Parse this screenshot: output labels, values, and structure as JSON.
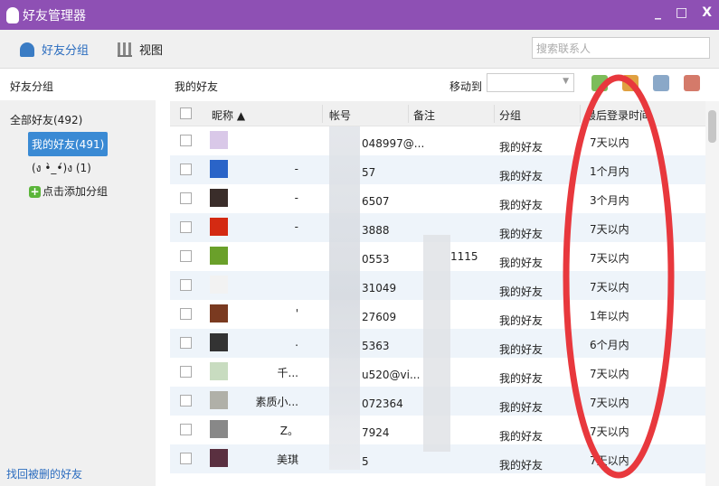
{
  "window": {
    "title": "好友管理器",
    "minimize": "_",
    "maximize": "□",
    "close": "X"
  },
  "toolbar": {
    "groups_tab": "好友分组",
    "view_tab": "视图",
    "search_placeholder": "搜索联系人"
  },
  "sidebar": {
    "header": "好友分组",
    "all": "全部好友(492)",
    "groups": [
      {
        "label": "我的好友(491)",
        "selected": true
      },
      {
        "label": "(ง •̀_•́)ง (1)",
        "selected": false
      }
    ],
    "add_group": "点击添加分组",
    "recover": "找回被删的好友"
  },
  "main": {
    "title": "我的好友",
    "move_to": "移动到"
  },
  "table": {
    "columns": [
      "昵称 ▲",
      "帐号",
      "备注",
      "分组",
      "最后登录时间"
    ],
    "rows": [
      {
        "nick": "",
        "account": "048997@...",
        "note": "",
        "group": "我的好友",
        "last": "7天以内",
        "avatar": "#d9c8e8"
      },
      {
        "nick": "-",
        "account": "57",
        "note": "",
        "group": "我的好友",
        "last": "1个月内",
        "avatar": "#2a64c8"
      },
      {
        "nick": "-",
        "account": "6507",
        "note": "",
        "group": "我的好友",
        "last": "3个月内",
        "avatar": "#3a2d2a"
      },
      {
        "nick": "-",
        "account": "3888",
        "note": "",
        "group": "我的好友",
        "last": "7天以内",
        "avatar": "#d42a12"
      },
      {
        "nick": "",
        "account": "0553",
        "note": "1115",
        "group": "我的好友",
        "last": "7天以内",
        "avatar": "#6aa02a"
      },
      {
        "nick": "",
        "account": "31049",
        "note": "",
        "group": "我的好友",
        "last": "7天以内",
        "avatar": "#f2f2f2"
      },
      {
        "nick": "'",
        "account": "27609",
        "note": "",
        "group": "我的好友",
        "last": "1年以内",
        "avatar": "#7a3a20"
      },
      {
        "nick": ".",
        "account": "5363",
        "note": "",
        "group": "我的好友",
        "last": "6个月内",
        "avatar": "#333"
      },
      {
        "nick": "千...",
        "account": "u520@vi...",
        "note": "",
        "group": "我的好友",
        "last": "7天以内",
        "avatar": "#c8dcc0"
      },
      {
        "nick": "素质小...",
        "account": "072364",
        "note": "",
        "group": "我的好友",
        "last": "7天以内",
        "avatar": "#b0b0a8"
      },
      {
        "nick": "Z。",
        "account": "7924",
        "note": "",
        "group": "我的好友",
        "last": "7天以内",
        "avatar": "#888"
      },
      {
        "nick": "美琪",
        "account": "5",
        "note": "",
        "group": "我的好友",
        "last": "7天以内",
        "avatar": "#5a3040"
      }
    ]
  },
  "colors": {
    "title_bar": "#8e50b4",
    "selected": "#3a8ad4",
    "annotation": "#e8383d"
  }
}
